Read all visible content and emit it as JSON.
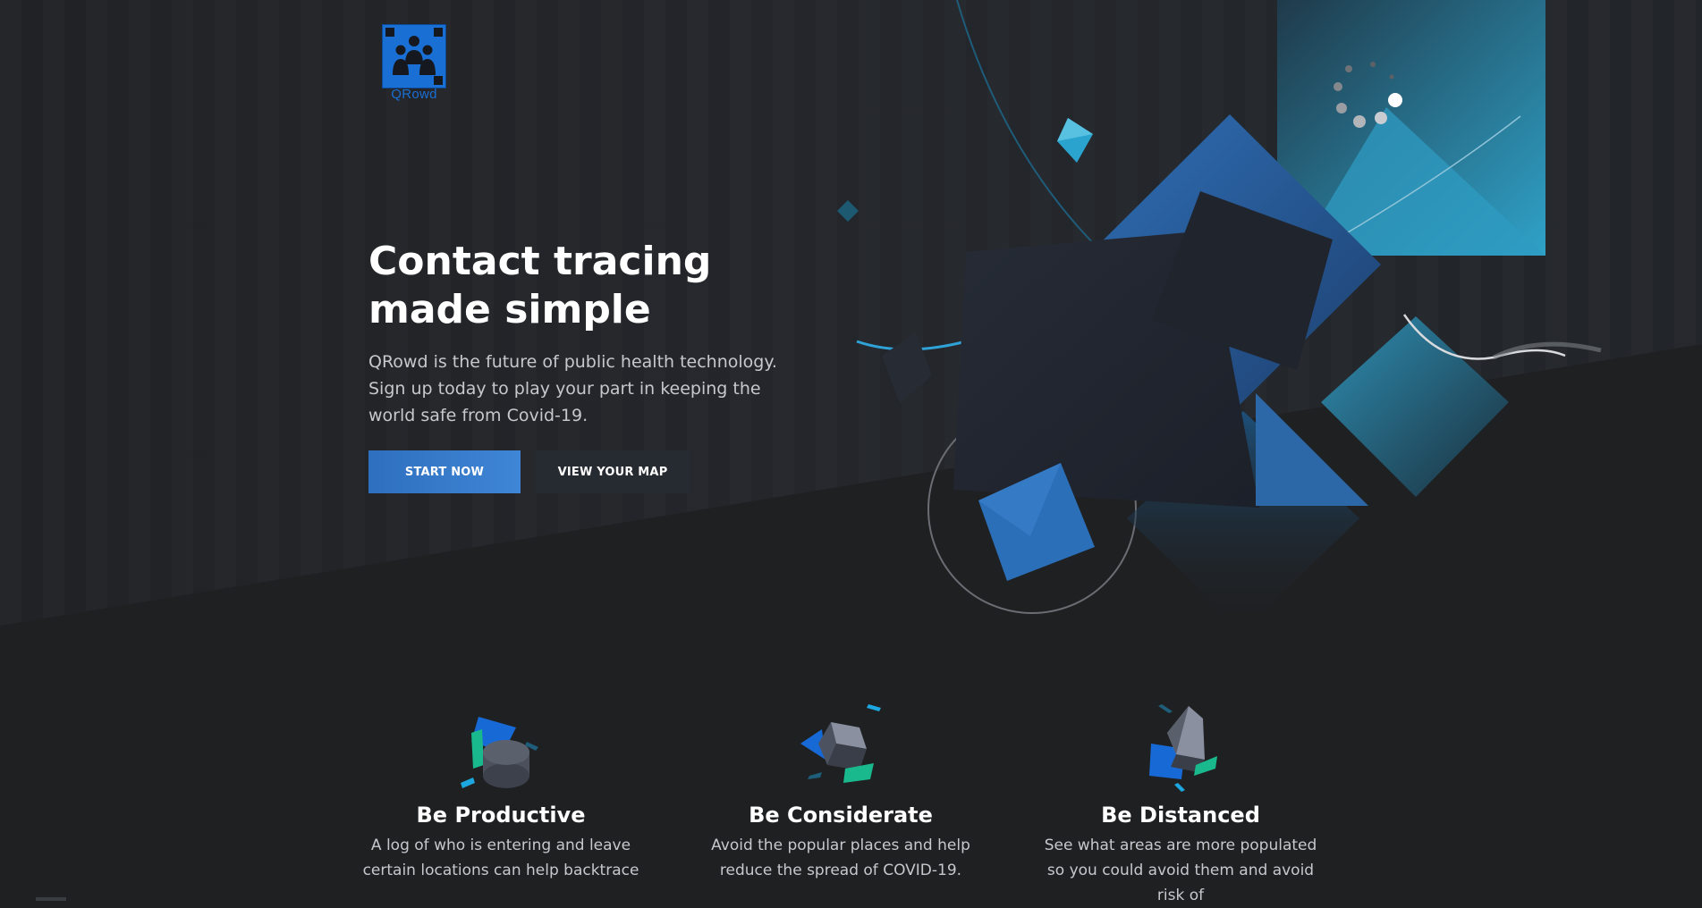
{
  "brand": {
    "logo_text": "QRowd"
  },
  "hero": {
    "headline": "Contact tracing made simple",
    "subtext": "QRowd is the future of public health technology. Sign up today to play your part in keeping the world safe from Covid-19.",
    "primary_button": "START NOW",
    "secondary_button": "VIEW YOUR MAP"
  },
  "features": [
    {
      "title": "Be Productive",
      "text": "A log of who is entering and leave certain locations can help backtrace",
      "icon": "cylinder-icon"
    },
    {
      "title": "Be Considerate",
      "text": "Avoid the popular places and help reduce the spread of COVID-19.",
      "icon": "cube-icon"
    },
    {
      "title": "Be Distanced",
      "text": "See what areas are more populated so you could avoid them and avoid risk of",
      "icon": "pyramid-icon"
    }
  ],
  "colors": {
    "background": "#1f2022",
    "accent_blue": "#2f6fbf",
    "teal": "#2e9cc4",
    "text_muted": "#c5c8cd"
  }
}
